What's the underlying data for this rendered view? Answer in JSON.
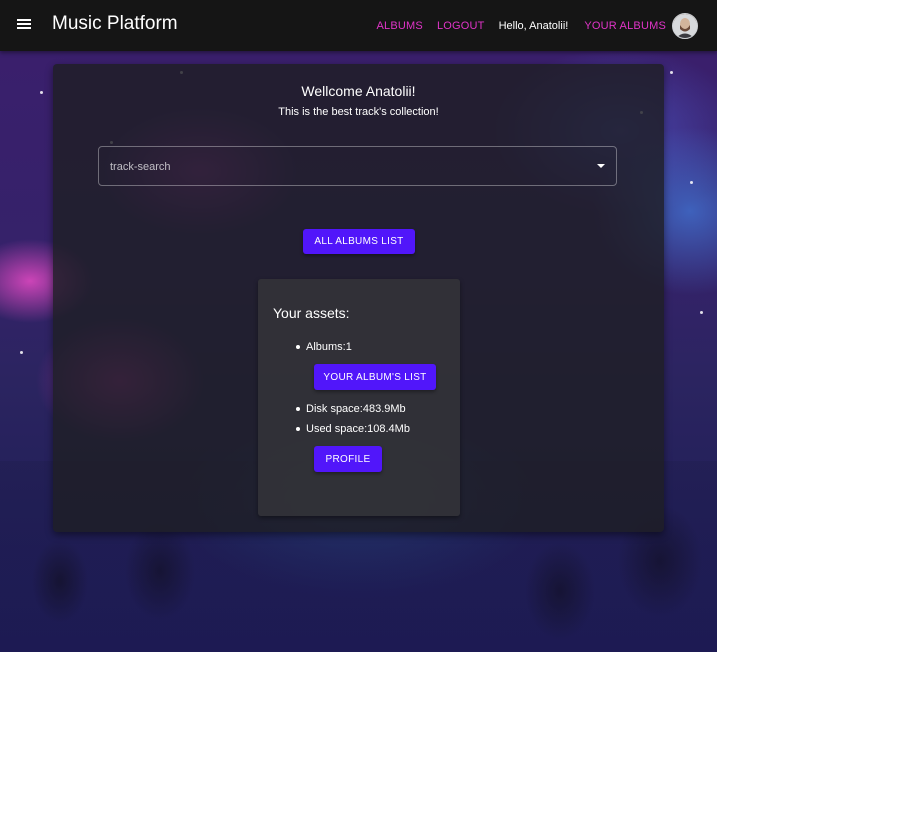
{
  "appbar": {
    "title": "Music Platform",
    "nav": {
      "albums": "ALBUMS",
      "logout": "LOGOUT",
      "greeting": "Hello, Anatolii!",
      "your_albums": "YOUR ALBUMS"
    },
    "menu_icon": "hamburger-menu-icon",
    "avatar_icon": "user-avatar"
  },
  "main": {
    "welcome": "Wellcome Anatolii!",
    "subtitle": "This is the best track's collection!",
    "search": {
      "placeholder": "track-search",
      "dropdown_icon": "arrow-drop-down-icon"
    },
    "all_albums_button": "ALL ALBUMS LIST"
  },
  "assets": {
    "title": "Your assets:",
    "albums": "Albums:1",
    "your_albums_button": "YOUR ALBUM'S LIST",
    "disk_space": "Disk space:483.9Mb",
    "used_space": "Used space:108.4Mb",
    "profile_button": "PROFILE"
  },
  "colors": {
    "accent": "#5116fa",
    "nav_link": "#e034c8",
    "appbar_bg": "#151515"
  }
}
